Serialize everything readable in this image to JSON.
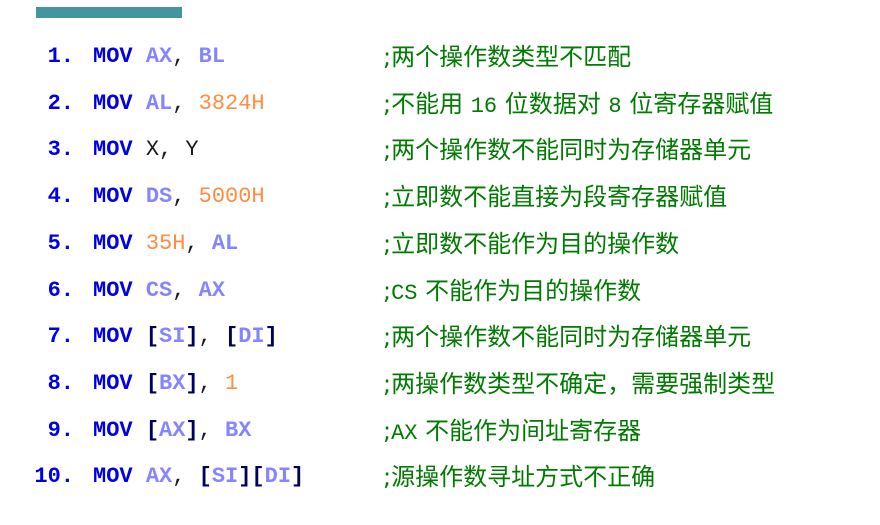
{
  "colors": {
    "opcode": "#0000e6",
    "register": "#8585ff",
    "immediate": "#ff8c40",
    "bracket": "#00005a",
    "comment": "#007a00",
    "accent_bar": "#45959f"
  },
  "lines": [
    {
      "num": "1.",
      "code": [
        [
          "op",
          "MOV"
        ],
        [
          "sym",
          " "
        ],
        [
          "reg",
          "AX"
        ],
        [
          "sym",
          ", "
        ],
        [
          "reg",
          "BL"
        ]
      ],
      "comment": [
        [
          "t",
          ";两个操作数类型不匹配"
        ]
      ]
    },
    {
      "num": "2.",
      "code": [
        [
          "op",
          "MOV"
        ],
        [
          "sym",
          " "
        ],
        [
          "reg",
          "AL"
        ],
        [
          "sym",
          ", "
        ],
        [
          "imm",
          "3824H"
        ]
      ],
      "comment": [
        [
          "t",
          ";不能用 "
        ],
        [
          "m",
          "16"
        ],
        [
          "t",
          " 位数据对 "
        ],
        [
          "m",
          "8"
        ],
        [
          "t",
          " 位寄存器赋值"
        ]
      ]
    },
    {
      "num": "3.",
      "code": [
        [
          "op",
          "MOV"
        ],
        [
          "sym",
          " "
        ],
        [
          "pl",
          "X, Y"
        ]
      ],
      "comment": [
        [
          "t",
          ";两个操作数不能同时为存储器单元"
        ]
      ]
    },
    {
      "num": "4.",
      "code": [
        [
          "op",
          "MOV"
        ],
        [
          "sym",
          " "
        ],
        [
          "reg",
          "DS"
        ],
        [
          "sym",
          ", "
        ],
        [
          "imm",
          "5000H"
        ]
      ],
      "comment": [
        [
          "t",
          ";立即数不能直接为段寄存器赋值"
        ]
      ]
    },
    {
      "num": "5.",
      "code": [
        [
          "op",
          "MOV"
        ],
        [
          "sym",
          " "
        ],
        [
          "imm",
          "35H"
        ],
        [
          "sym",
          ", "
        ],
        [
          "reg",
          "AL"
        ]
      ],
      "comment": [
        [
          "t",
          ";立即数不能作为目的操作数"
        ]
      ]
    },
    {
      "num": "6.",
      "code": [
        [
          "op",
          "MOV"
        ],
        [
          "sym",
          " "
        ],
        [
          "reg",
          "CS"
        ],
        [
          "sym",
          ", "
        ],
        [
          "reg",
          "AX"
        ]
      ],
      "comment": [
        [
          "t",
          ";"
        ],
        [
          "m",
          "CS"
        ],
        [
          "t",
          " 不能作为目的操作数"
        ]
      ]
    },
    {
      "num": "7.",
      "code": [
        [
          "op",
          "MOV"
        ],
        [
          "sym",
          " "
        ],
        [
          "br",
          "["
        ],
        [
          "reg",
          "SI"
        ],
        [
          "br",
          "]"
        ],
        [
          "sym",
          ", "
        ],
        [
          "br",
          "["
        ],
        [
          "reg",
          "DI"
        ],
        [
          "br",
          "]"
        ]
      ],
      "comment": [
        [
          "t",
          ";两个操作数不能同时为存储器单元"
        ]
      ]
    },
    {
      "num": "8.",
      "code": [
        [
          "op",
          "MOV"
        ],
        [
          "sym",
          " "
        ],
        [
          "br",
          "["
        ],
        [
          "reg",
          "BX"
        ],
        [
          "br",
          "]"
        ],
        [
          "sym",
          ", "
        ],
        [
          "imm",
          "1"
        ]
      ],
      "comment": [
        [
          "t",
          ";两操作数类型不确定，需要强制类型"
        ]
      ]
    },
    {
      "num": "9.",
      "code": [
        [
          "op",
          "MOV"
        ],
        [
          "sym",
          " "
        ],
        [
          "br",
          "["
        ],
        [
          "reg",
          "AX"
        ],
        [
          "br",
          "]"
        ],
        [
          "sym",
          ", "
        ],
        [
          "reg",
          "BX"
        ]
      ],
      "comment": [
        [
          "t",
          ";"
        ],
        [
          "m",
          "AX"
        ],
        [
          "t",
          " 不能作为间址寄存器"
        ]
      ]
    },
    {
      "num": "10.",
      "code": [
        [
          "op",
          "MOV"
        ],
        [
          "sym",
          " "
        ],
        [
          "reg",
          "AX"
        ],
        [
          "sym",
          ", "
        ],
        [
          "br",
          "["
        ],
        [
          "reg",
          "SI"
        ],
        [
          "br",
          "]["
        ],
        [
          "reg",
          "DI"
        ],
        [
          "br",
          "]"
        ]
      ],
      "comment": [
        [
          "t",
          ";源操作数寻址方式不正确"
        ]
      ]
    }
  ]
}
